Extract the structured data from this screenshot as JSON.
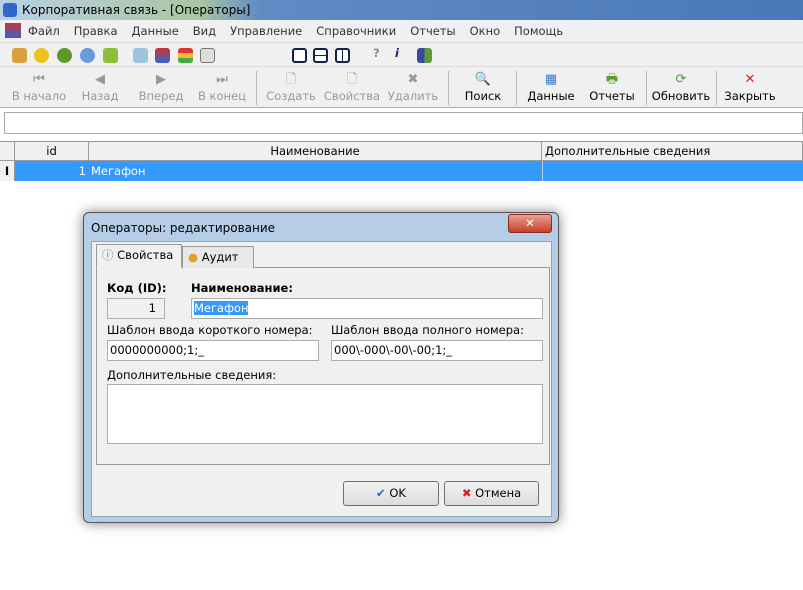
{
  "window": {
    "title": "Корпоративная связь - [Операторы]"
  },
  "menu": [
    "Файл",
    "Правка",
    "Данные",
    "Вид",
    "Управление",
    "Справочники",
    "Отчеты",
    "Окно",
    "Помощь"
  ],
  "toolbar": {
    "first": "В начало",
    "prev": "Назад",
    "next": "Вперед",
    "last": "В конец",
    "create": "Создать",
    "props": "Свойства",
    "delete": "Удалить",
    "search": "Поиск",
    "data": "Данные",
    "reports": "Отчеты",
    "refresh": "Обновить",
    "close": "Закрыть"
  },
  "grid": {
    "columns": [
      "id",
      "Наименование",
      "Дополнительные сведения"
    ],
    "rows": [
      {
        "id": "1",
        "name": "Мегафон",
        "info": ""
      }
    ],
    "row_marker": "I"
  },
  "dialog": {
    "title": "Операторы: редактирование",
    "close": "✕",
    "tabs": [
      "Свойства",
      "Аудит"
    ],
    "id_label": "Код (ID):",
    "id_value": "1",
    "name_label": "Наименование:",
    "name_value": "Мегафон",
    "short_label": "Шаблон ввода короткого номера:",
    "short_value": "0000000000;1;_",
    "full_label": "Шаблон ввода полного номера:",
    "full_value": "000\\-000\\-00\\-00;1;_",
    "info_label": "Дополнительные сведения:",
    "info_value": "",
    "ok": "OK",
    "cancel": "Отмена"
  }
}
